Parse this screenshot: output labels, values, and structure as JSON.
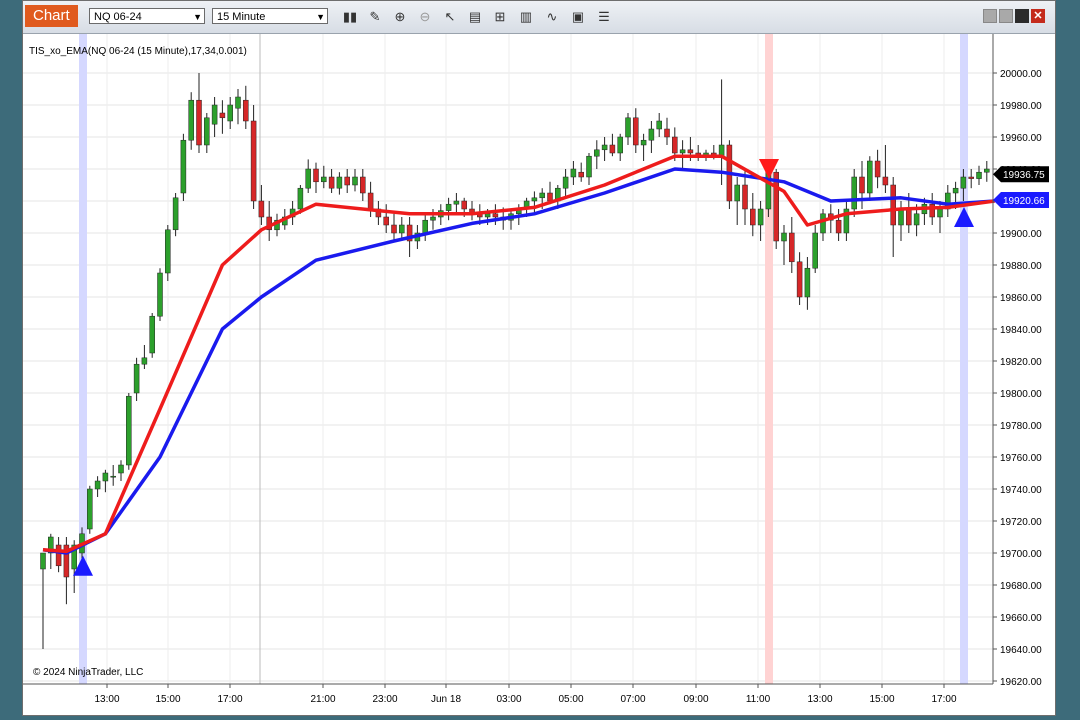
{
  "toolbar": {
    "tab_label": "Chart",
    "instrument": "NQ 06-24",
    "interval": "15 Minute",
    "tools": [
      "bar-chart-icon",
      "pencil-icon",
      "zoom-in-icon",
      "zoom-out-icon",
      "pointer-icon",
      "data-box-icon",
      "properties-icon",
      "indicators-icon",
      "strategies-icon",
      "screenshot-icon",
      "list-icon"
    ]
  },
  "chart_data": {
    "type": "candlestick",
    "title": "TIS_xo_EMA(NQ 06-24 (15 Minute),17,34,0.001)",
    "copyright": "© 2024 NinjaTrader, LLC",
    "ylim": [
      19620,
      20010
    ],
    "y_ticks": [
      "20000.00",
      "19980.00",
      "19960.00",
      "19940.00",
      "19920.00",
      "19900.00",
      "19880.00",
      "19860.00",
      "19840.00",
      "19820.00",
      "19800.00",
      "19780.00",
      "19760.00",
      "19740.00",
      "19720.00",
      "19700.00",
      "19680.00",
      "19660.00",
      "19640.00",
      "19620.00"
    ],
    "x_ticks": [
      "13:00",
      "15:00",
      "17:00",
      "21:00",
      "23:00",
      "Jun 18",
      "03:00",
      "05:00",
      "07:00",
      "09:00",
      "11:00",
      "13:00",
      "15:00",
      "17:00"
    ],
    "price_labels": [
      {
        "text": "19936.75",
        "value": 19936.75,
        "color": "#000000"
      },
      {
        "text": "19920.66",
        "value": 19920.66,
        "color": "#1a1aff"
      }
    ],
    "signals": [
      {
        "type": "buy",
        "x_tick": "13:00",
        "value": 19692,
        "color": "#1a1aff"
      },
      {
        "type": "sell",
        "x_tick": "11:00",
        "value": 19940,
        "color": "#ff1a1a"
      },
      {
        "type": "buy",
        "x_tick": "17:00",
        "value": 19910,
        "color": "#1a1aff"
      }
    ],
    "series": [
      {
        "kind": "ohlc",
        "values": [
          [
            19690,
            19700,
            19640,
            19700
          ],
          [
            19700,
            19712,
            19690,
            19710
          ],
          [
            19705,
            19710,
            19688,
            19692
          ],
          [
            19705,
            19710,
            19668,
            19685
          ],
          [
            19690,
            19708,
            19675,
            19705
          ],
          [
            19700,
            19716,
            19695,
            19712
          ],
          [
            19715,
            19742,
            19712,
            19740
          ],
          [
            19740,
            19748,
            19735,
            19745
          ],
          [
            19745,
            19752,
            19738,
            19750
          ],
          [
            19748,
            19755,
            19742,
            19748
          ],
          [
            19750,
            19758,
            19745,
            19755
          ],
          [
            19755,
            19800,
            19752,
            19798
          ],
          [
            19800,
            19822,
            19795,
            19818
          ],
          [
            19818,
            19830,
            19815,
            19822
          ],
          [
            19825,
            19850,
            19822,
            19848
          ],
          [
            19848,
            19878,
            19845,
            19875
          ],
          [
            19875,
            19905,
            19870,
            19902
          ],
          [
            19902,
            19925,
            19898,
            19922
          ],
          [
            19925,
            19962,
            19920,
            19958
          ],
          [
            19958,
            19988,
            19952,
            19983
          ],
          [
            19983,
            20000,
            19950,
            19955
          ],
          [
            19955,
            19975,
            19950,
            19972
          ],
          [
            19968,
            19985,
            19960,
            19980
          ],
          [
            19975,
            19983,
            19962,
            19972
          ],
          [
            19970,
            19985,
            19965,
            19980
          ],
          [
            19978,
            19990,
            19968,
            19985
          ],
          [
            19983,
            19992,
            19965,
            19970
          ],
          [
            19970,
            19980,
            19915,
            19920
          ],
          [
            19920,
            19930,
            19905,
            19910
          ],
          [
            19910,
            19920,
            19895,
            19902
          ],
          [
            19902,
            19912,
            19898,
            19908
          ],
          [
            19905,
            19915,
            19902,
            19910
          ],
          [
            19910,
            19920,
            19905,
            19915
          ],
          [
            19915,
            19930,
            19912,
            19928
          ],
          [
            19928,
            19946,
            19925,
            19940
          ],
          [
            19940,
            19944,
            19925,
            19932
          ],
          [
            19932,
            19942,
            19928,
            19935
          ],
          [
            19935,
            19940,
            19925,
            19928
          ],
          [
            19928,
            19938,
            19924,
            19935
          ],
          [
            19935,
            19940,
            19925,
            19930
          ],
          [
            19930,
            19940,
            19926,
            19935
          ],
          [
            19935,
            19940,
            19920,
            19925
          ],
          [
            19925,
            19932,
            19910,
            19915
          ],
          [
            19915,
            19920,
            19905,
            19910
          ],
          [
            19910,
            19918,
            19900,
            19905
          ],
          [
            19905,
            19912,
            19895,
            19900
          ],
          [
            19900,
            19910,
            19895,
            19905
          ],
          [
            19905,
            19910,
            19885,
            19895
          ],
          [
            19895,
            19905,
            19890,
            19900
          ],
          [
            19900,
            19912,
            19895,
            19908
          ],
          [
            19908,
            19915,
            19902,
            19910
          ],
          [
            19910,
            19918,
            19905,
            19914
          ],
          [
            19914,
            19922,
            19908,
            19918
          ],
          [
            19918,
            19925,
            19912,
            19920
          ],
          [
            19920,
            19922,
            19910,
            19915
          ],
          [
            19915,
            19920,
            19908,
            19912
          ],
          [
            19912,
            19918,
            19905,
            19910
          ],
          [
            19910,
            19915,
            19905,
            19912
          ],
          [
            19912,
            19918,
            19905,
            19910
          ],
          [
            19910,
            19916,
            19902,
            19908
          ],
          [
            19908,
            19914,
            19902,
            19912
          ],
          [
            19912,
            19918,
            19905,
            19915
          ],
          [
            19915,
            19922,
            19910,
            19920
          ],
          [
            19920,
            19926,
            19912,
            19922
          ],
          [
            19922,
            19928,
            19915,
            19925
          ],
          [
            19925,
            19932,
            19918,
            19920
          ],
          [
            19920,
            19930,
            19915,
            19928
          ],
          [
            19928,
            19940,
            19922,
            19935
          ],
          [
            19935,
            19945,
            19930,
            19940
          ],
          [
            19938,
            19944,
            19932,
            19935
          ],
          [
            19935,
            19950,
            19930,
            19948
          ],
          [
            19948,
            19958,
            19940,
            19952
          ],
          [
            19952,
            19960,
            19945,
            19955
          ],
          [
            19955,
            19962,
            19948,
            19950
          ],
          [
            19950,
            19962,
            19945,
            19960
          ],
          [
            19960,
            19975,
            19955,
            19972
          ],
          [
            19972,
            19978,
            19950,
            19955
          ],
          [
            19955,
            19962,
            19945,
            19958
          ],
          [
            19958,
            19970,
            19950,
            19965
          ],
          [
            19965,
            19975,
            19960,
            19970
          ],
          [
            19965,
            19972,
            19955,
            19960
          ],
          [
            19960,
            19966,
            19945,
            19950
          ],
          [
            19950,
            19958,
            19940,
            19952
          ],
          [
            19952,
            19960,
            19945,
            19950
          ],
          [
            19950,
            19955,
            19945,
            19948
          ],
          [
            19948,
            19952,
            19945,
            19950
          ],
          [
            19950,
            19955,
            19946,
            19948
          ],
          [
            19948,
            19996,
            19930,
            19955
          ],
          [
            19955,
            19958,
            19915,
            19920
          ],
          [
            19920,
            19935,
            19905,
            19930
          ],
          [
            19930,
            19940,
            19905,
            19915
          ],
          [
            19915,
            19925,
            19898,
            19905
          ],
          [
            19905,
            19920,
            19895,
            19915
          ],
          [
            19915,
            19942,
            19910,
            19938
          ],
          [
            19938,
            19940,
            19890,
            19895
          ],
          [
            19895,
            19905,
            19880,
            19900
          ],
          [
            19900,
            19910,
            19875,
            19882
          ],
          [
            19882,
            19888,
            19855,
            19860
          ],
          [
            19860,
            19885,
            19852,
            19878
          ],
          [
            19878,
            19905,
            19875,
            19900
          ],
          [
            19900,
            19915,
            19895,
            19912
          ],
          [
            19912,
            19918,
            19900,
            19908
          ],
          [
            19908,
            19915,
            19895,
            19900
          ],
          [
            19900,
            19920,
            19895,
            19915
          ],
          [
            19915,
            19940,
            19910,
            19935
          ],
          [
            19935,
            19945,
            19915,
            19925
          ],
          [
            19925,
            19948,
            19920,
            19945
          ],
          [
            19945,
            19952,
            19928,
            19935
          ],
          [
            19935,
            19955,
            19925,
            19930
          ],
          [
            19930,
            19935,
            19885,
            19905
          ],
          [
            19905,
            19920,
            19895,
            19915
          ],
          [
            19915,
            19925,
            19900,
            19905
          ],
          [
            19905,
            19918,
            19898,
            19912
          ],
          [
            19912,
            19922,
            19905,
            19918
          ],
          [
            19918,
            19925,
            19905,
            19910
          ],
          [
            19910,
            19920,
            19900,
            19915
          ],
          [
            19915,
            19930,
            19910,
            19925
          ],
          [
            19925,
            19932,
            19915,
            19928
          ],
          [
            19928,
            19940,
            19920,
            19935
          ],
          [
            19935,
            19940,
            19928,
            19934
          ],
          [
            19934,
            19942,
            19930,
            19938
          ],
          [
            19938,
            19945,
            19932,
            19940
          ]
        ]
      },
      {
        "kind": "line",
        "color": "#ee1c1c",
        "values": [
          [
            0,
            19702
          ],
          [
            3,
            19701
          ],
          [
            8,
            19712
          ],
          [
            15,
            19790
          ],
          [
            23,
            19880
          ],
          [
            28,
            19902
          ],
          [
            35,
            19918
          ],
          [
            47,
            19912
          ],
          [
            55,
            19912
          ],
          [
            63,
            19916
          ],
          [
            72,
            19930
          ],
          [
            81,
            19948
          ],
          [
            87,
            19948
          ],
          [
            95,
            19926
          ],
          [
            98,
            19905
          ],
          [
            103,
            19912
          ],
          [
            110,
            19915
          ],
          [
            116,
            19916
          ],
          [
            122,
            19920
          ]
        ]
      },
      {
        "kind": "line",
        "color": "#1a1aee",
        "values": [
          [
            0,
            19702
          ],
          [
            3,
            19700
          ],
          [
            8,
            19712
          ],
          [
            15,
            19760
          ],
          [
            23,
            19840
          ],
          [
            28,
            19860
          ],
          [
            35,
            19883
          ],
          [
            45,
            19895
          ],
          [
            55,
            19906
          ],
          [
            63,
            19912
          ],
          [
            72,
            19925
          ],
          [
            81,
            19940
          ],
          [
            87,
            19938
          ],
          [
            95,
            19932
          ],
          [
            101,
            19920
          ],
          [
            110,
            19922
          ],
          [
            116,
            19918
          ],
          [
            122,
            19920
          ]
        ]
      }
    ]
  }
}
